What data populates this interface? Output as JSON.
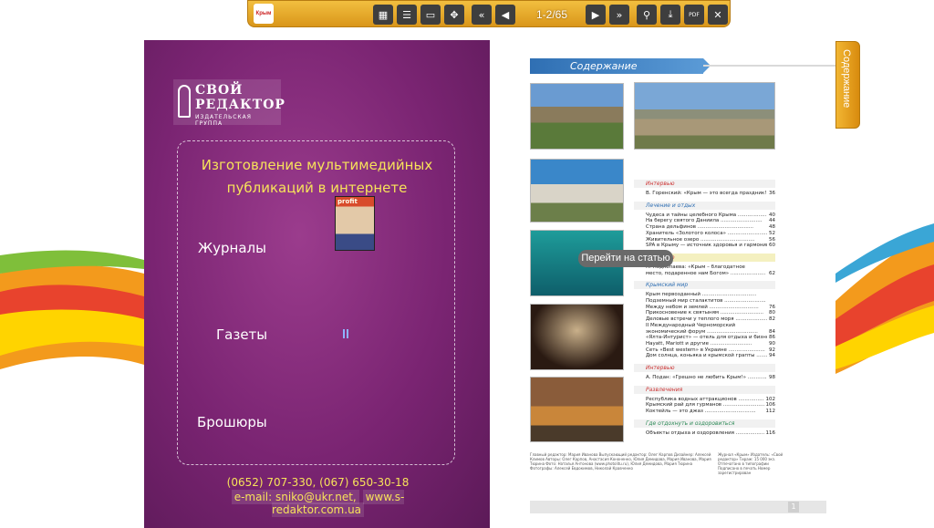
{
  "toolbar": {
    "logo_text": "Крым",
    "page_indicator": "1-2/65",
    "buttons": [
      {
        "name": "thumbnails",
        "icon": "thumbnails-icon"
      },
      {
        "name": "contents",
        "icon": "list-icon"
      },
      {
        "name": "open",
        "icon": "folder-open-icon"
      },
      {
        "name": "fullscreen",
        "icon": "fullscreen-icon"
      },
      {
        "name": "first-page",
        "icon": "double-chevron-left-icon"
      },
      {
        "name": "prev-page",
        "icon": "triangle-left-icon"
      },
      {
        "name": "next-page",
        "icon": "triangle-right-icon"
      },
      {
        "name": "last-page",
        "icon": "double-chevron-right-icon"
      },
      {
        "name": "search",
        "icon": "search-icon"
      },
      {
        "name": "download",
        "icon": "download-icon"
      },
      {
        "name": "pdf",
        "icon": "pdf-tools-icon",
        "label": "PDF"
      },
      {
        "name": "close",
        "icon": "close-icon"
      }
    ]
  },
  "side_tab": {
    "label": "Содержание"
  },
  "tooltip": {
    "text": "Перейти на статью"
  },
  "left_page": {
    "brand": {
      "line1": "СВОЙ",
      "line2": "РЕДАКТОР",
      "line3": "ИЗДАТЕЛЬСКАЯ ГРУППА"
    },
    "promo_title_1": "Изготовление мультимедийных",
    "promo_title_2": "публикаций в интернете",
    "magazine_label": "profit",
    "categories": [
      "Журналы",
      "Газеты",
      "Брошюры"
    ],
    "contact_phones": "(0652) 707-330, (067) 650-30-18",
    "contact_email": "e-mail: sniko@ukr.net,",
    "contact_site": "www.s-redaktor.com.ua"
  },
  "right_page": {
    "toc_title": "Содержание",
    "page_number": "1",
    "sections": [
      {
        "title": "Интервью",
        "style": "red",
        "items": [
          {
            "text": "В. Горенский: «Крым — это всегда праздник!» ........",
            "page": "36"
          }
        ]
      },
      {
        "title": "Лечение и отдых",
        "style": "blue",
        "items": [
          {
            "text": "Чудеса и тайны целебного Крыма ......................",
            "page": "40"
          },
          {
            "text": "На берегу святого Даниила ..........................",
            "page": "44"
          },
          {
            "text": "Страна дельфинов ...................................",
            "page": "48"
          },
          {
            "text": "Хранитель «Золотого колоса» .........................",
            "page": "52"
          },
          {
            "text": "Живительное озеро ..................................",
            "page": "56"
          },
          {
            "text": "SPA в Крыму — источник здоровья и гармонии ..........",
            "page": "60"
          }
        ]
      },
      {
        "title": "Интервью",
        "style": "red-yellow",
        "items": [
          {
            "text": "Л. Подкопаева: «Крым – благодатное",
            "page": ""
          },
          {
            "text": "место, подаренное нам Богом» ......................",
            "page": "62"
          }
        ]
      },
      {
        "title": "Крымский мир",
        "style": "blue",
        "items": [
          {
            "text": "Крым первозданный ..................................",
            "page": ""
          },
          {
            "text": "Подземный мир сталактитов ..........................",
            "page": ""
          },
          {
            "text": "Между небом и землей ...............................",
            "page": "76"
          },
          {
            "text": "Прикосновение к святыням ...........................",
            "page": "80"
          },
          {
            "text": "Деловые встречи у теплого моря .....................",
            "page": "82"
          },
          {
            "text": "II  Международный  Черноморский",
            "page": ""
          },
          {
            "text": "экономический форум ................................",
            "page": "84"
          },
          {
            "text": "«Ялта-Интурист» — отель для отдыха и бизнеса ........",
            "page": "86"
          },
          {
            "text": "Hayatt, Mariott  и другие ..........................",
            "page": "90"
          },
          {
            "text": "Сеть «Best western» в Украине .......................",
            "page": "92"
          },
          {
            "text": "Дом солнца, коньяка и крымской грапты ...............",
            "page": "94"
          }
        ]
      },
      {
        "title": "Интервью",
        "style": "red",
        "items": [
          {
            "text": "А. Подан: «Грешно не любить Крым!» ..................",
            "page": "98"
          }
        ]
      },
      {
        "title": "Развлечения",
        "style": "red",
        "items": [
          {
            "text": "Республика водных аттракционов .....................",
            "page": "102"
          },
          {
            "text": "Крымский рай для гурманов ..........................",
            "page": "106"
          },
          {
            "text": "Коктейль — это джаз ................................",
            "page": "112"
          }
        ]
      },
      {
        "title": "Где отдохнуть и оздоровиться",
        "style": "green",
        "items": [
          {
            "text": "Объекты отдыха и оздоровления .......................",
            "page": "116"
          }
        ]
      }
    ],
    "footer_left": "Главный редактор: Мария Иванова  Выпускающий редактор: Олег Карпов  Дизайнер: Алексей Климов  Авторы: Олег Карпов, Анастасия Кононенко, Юлия Демидова, Мария Иванова, Мария Тюрина  Фото: Наталья Антонова (www.photolitu.ru), Юлия Демидова, Мария Тюрина  Фотографы: Алексей Евдокимов, Николай Кравченко",
    "footer_right": "Журнал «Крым»  Издатель: «Свой редактор»  Тираж: 15 000 экз.  Отпечатано в типографии  Подписано в печать  Номер зарегистрирован"
  }
}
